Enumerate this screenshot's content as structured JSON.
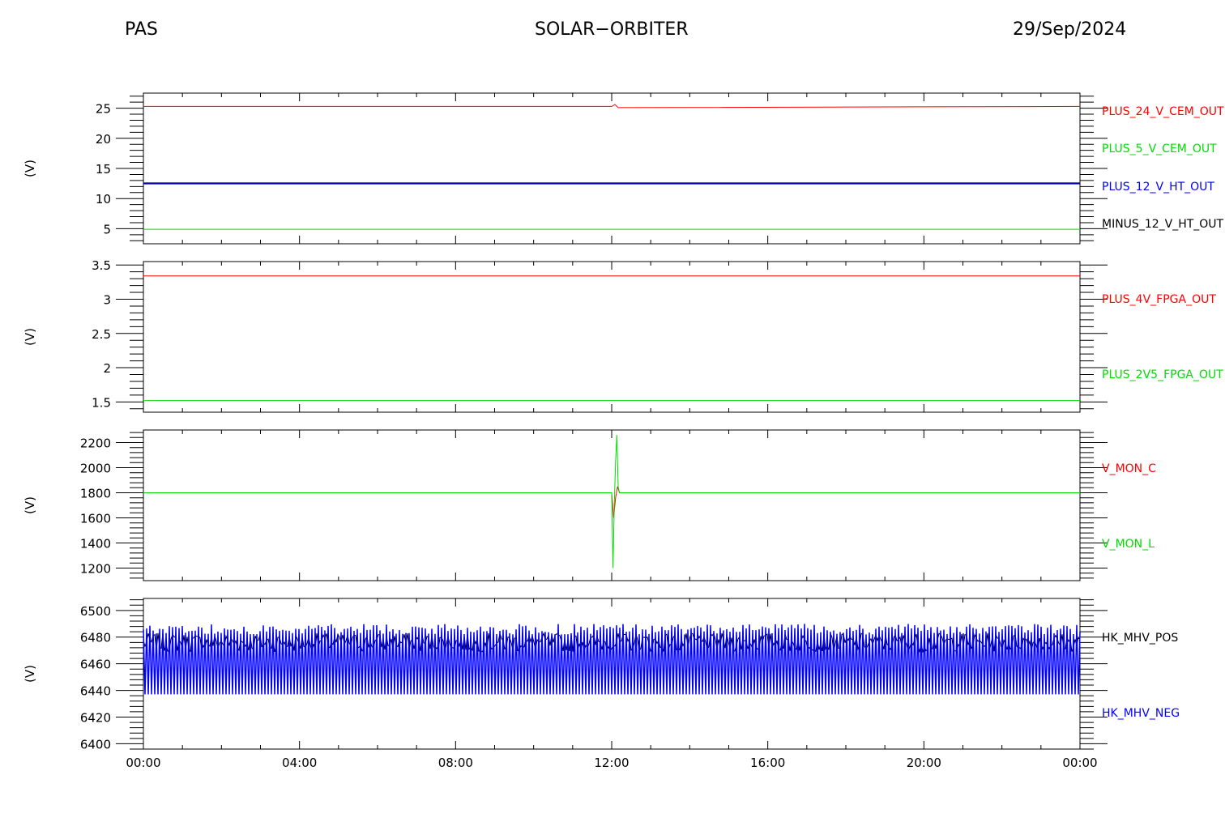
{
  "header": {
    "instrument": "PAS",
    "mission": "SOLAR−ORBITER",
    "date": "29/Sep/2024"
  },
  "colors": {
    "red": "#ff0000",
    "green": "#00dd00",
    "blue": "#0000ff",
    "navy": "#000080",
    "black": "#000000"
  },
  "chart_data": [
    {
      "type": "line",
      "ylabel": "(V)",
      "ylim": [
        2.5,
        27.5
      ],
      "yticks": [
        5,
        10,
        15,
        20,
        25
      ],
      "xlim": [
        "00:00",
        "24:00"
      ],
      "series": [
        {
          "name": "PLUS_24_V_CEM_OUT",
          "color": "#ff0000",
          "x": [
            "00:00",
            "12:00",
            "12:05",
            "12:10",
            "24:00"
          ],
          "y": [
            25.3,
            25.3,
            25.6,
            25.1,
            25.3
          ]
        },
        {
          "name": "PLUS_5_V_CEM_OUT",
          "color": "#00dd00",
          "x": [
            "00:00",
            "24:00"
          ],
          "y": [
            4.9,
            4.9
          ]
        },
        {
          "name": "PLUS_12_V_HT_OUT",
          "color": "#0000ff",
          "x": [
            "00:00",
            "24:00"
          ],
          "y": [
            12.5,
            12.5
          ]
        },
        {
          "name": "MINUS_12_V_HT_OUT",
          "color": "#000000",
          "x": [
            "00:00",
            "24:00"
          ],
          "y": [
            12.6,
            12.6
          ]
        }
      ]
    },
    {
      "type": "line",
      "ylabel": "(V)",
      "ylim": [
        1.35,
        3.55
      ],
      "yticks": [
        1.5,
        2.0,
        2.5,
        3.0,
        3.5
      ],
      "xlim": [
        "00:00",
        "24:00"
      ],
      "series": [
        {
          "name": "PLUS_4V_FPGA_OUT",
          "color": "#ff0000",
          "x": [
            "00:00",
            "24:00"
          ],
          "y": [
            3.34,
            3.34
          ]
        },
        {
          "name": "PLUS_2V5_FPGA_OUT",
          "color": "#00dd00",
          "x": [
            "00:00",
            "24:00"
          ],
          "y": [
            1.52,
            1.52
          ]
        }
      ]
    },
    {
      "type": "line",
      "ylabel": "(V)",
      "ylim": [
        1100,
        2300
      ],
      "yticks": [
        1200,
        1400,
        1600,
        1800,
        2000,
        2200
      ],
      "xlim": [
        "00:00",
        "24:00"
      ],
      "series": [
        {
          "name": "V_MON_C",
          "color": "#ff0000",
          "x": [
            "00:00",
            "12:00",
            "12:03",
            "12:06",
            "12:09",
            "12:12",
            "24:00"
          ],
          "y": [
            1800,
            1800,
            1600,
            1760,
            1850,
            1800,
            1800
          ]
        },
        {
          "name": "V_MON_L",
          "color": "#00dd00",
          "x": [
            "00:00",
            "12:00",
            "12:02",
            "12:04",
            "12:06",
            "12:08",
            "12:10",
            "12:12",
            "24:00"
          ],
          "y": [
            1800,
            1800,
            1200,
            1700,
            2050,
            2260,
            1850,
            1800,
            1800
          ]
        }
      ]
    },
    {
      "type": "line",
      "ylabel": "(V)",
      "ylim": [
        6396,
        6509
      ],
      "yticks": [
        6400,
        6420,
        6440,
        6460,
        6480,
        6500
      ],
      "xlim": [
        "00:00",
        "24:00"
      ],
      "series": [
        {
          "name": "HK_MHV_POS",
          "color": "#000000",
          "base": 6476,
          "low": 6466,
          "high": 6484
        },
        {
          "name": "HK_MHV_NEG",
          "color": "#0000ff",
          "base": 6437,
          "low": 6437,
          "high": 6490
        }
      ]
    }
  ],
  "xaxis": {
    "ticks": [
      "00:00",
      "04:00",
      "08:00",
      "12:00",
      "16:00",
      "20:00",
      "00:00"
    ]
  }
}
